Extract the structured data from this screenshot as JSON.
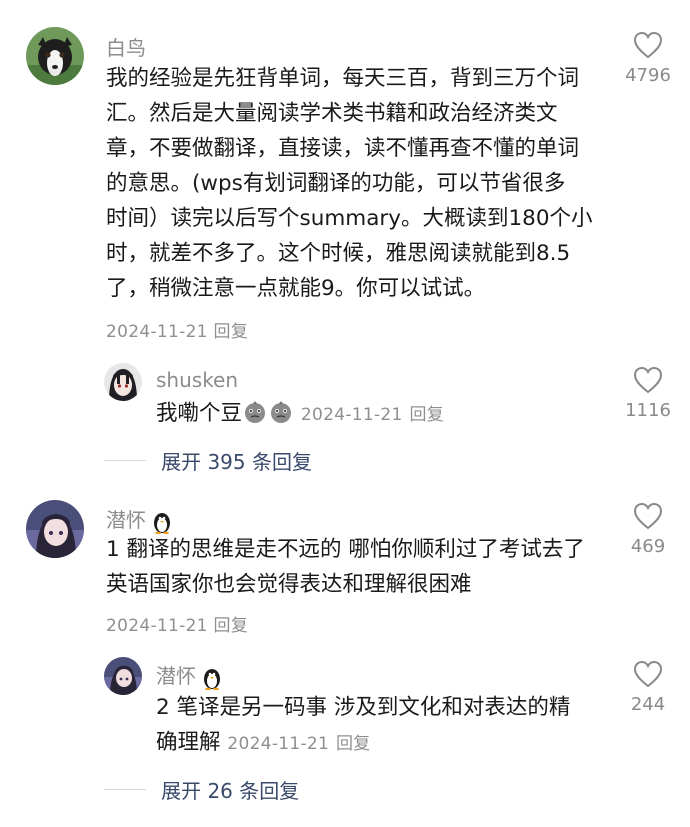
{
  "comments": [
    {
      "user": "白鸟",
      "lines": [
        "我的经验是先狂背单词，每天三百，背到三万个词",
        "汇。然后是大量阅读学术类书籍和政治经济类文",
        "章，不要做翻译，直接读，读不懂再查不懂的单词",
        "的意思。(wps有划词翻译的功能，可以节省很多",
        "时间）读完以后写个summary。大概读到180个小",
        "时，就差不多了。这个时候，雅思阅读就能到8.5",
        "了，稍微注意一点就能9。你可以试试。"
      ],
      "date": "2024-11-21",
      "reply_label": "回复",
      "likes": "4796",
      "reply": {
        "user": "shusken",
        "text": "我嘞个豆",
        "emojis": [
          "bean-emoji",
          "bean-emoji"
        ],
        "date": "2024-11-21",
        "reply_label": "回复",
        "likes": "1116"
      },
      "expand_label": "展开 395 条回复"
    },
    {
      "user": "潜怀",
      "badge_icon": "penguin-icon",
      "lines": [
        "1 翻译的思维是走不远的 哪怕你顺利过了考试去了",
        "英语国家你也会觉得表达和理解很困难"
      ],
      "date": "2024-11-21",
      "reply_label": "回复",
      "likes": "469",
      "reply": {
        "user": "潜怀",
        "badge_icon": "penguin-icon",
        "lines": [
          "2 笔译是另一码事 涉及到文化和对表达的精",
          "确理解"
        ],
        "date": "2024-11-21",
        "reply_label": "回复",
        "likes": "244"
      },
      "expand_label": "展开 26 条回复"
    }
  ],
  "colors": {
    "name": "#8c8c8c",
    "meta": "#8f8f8f",
    "expand": "#3a4a6b"
  }
}
